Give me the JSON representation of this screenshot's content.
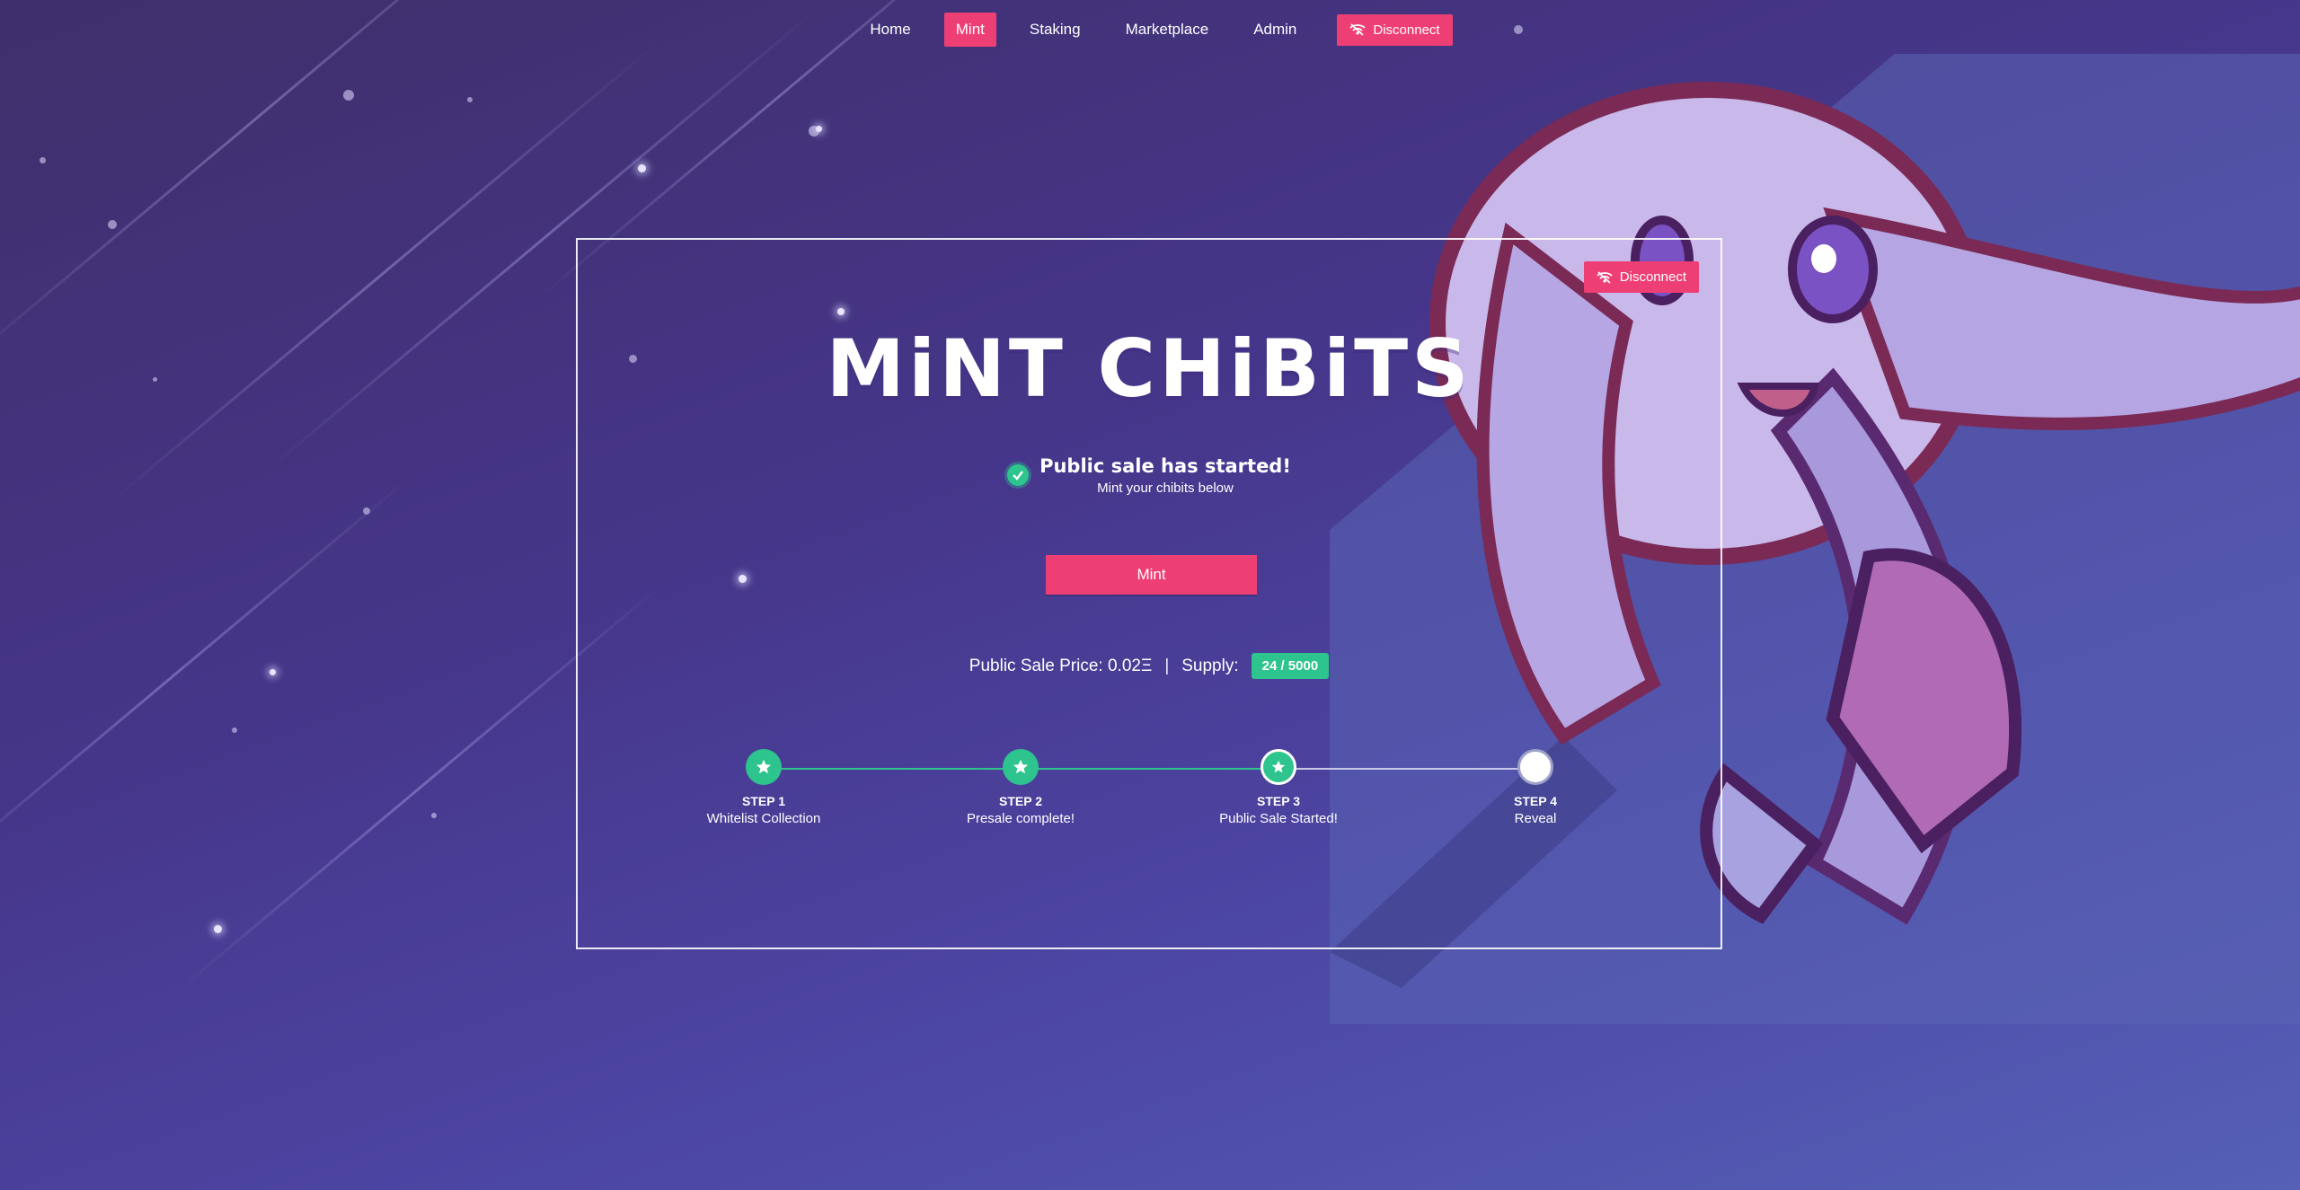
{
  "nav": {
    "items": [
      {
        "label": "Home",
        "active": false
      },
      {
        "label": "Mint",
        "active": true
      },
      {
        "label": "Staking",
        "active": false
      },
      {
        "label": "Marketplace",
        "active": false
      },
      {
        "label": "Admin",
        "active": false
      }
    ],
    "disconnect_label": "Disconnect",
    "disconnect_icon": "wifi-off-icon"
  },
  "mint_panel": {
    "disconnect_label": "Disconnect",
    "title": "MiNT CHiBiTS",
    "status_title": "Public sale has started!",
    "status_subtitle": "Mint your chibits below",
    "mint_button_label": "Mint",
    "price_text": "Public Sale Price: 0.02Ξ",
    "separator": "|",
    "supply_label": "Supply:",
    "supply_value": "24 / 5000"
  },
  "steps": [
    {
      "number": "STEP 1",
      "label": "Whitelist Collection",
      "state": "done"
    },
    {
      "number": "STEP 2",
      "label": "Presale complete!",
      "state": "done"
    },
    {
      "number": "STEP 3",
      "label": "Public Sale Started!",
      "state": "current"
    },
    {
      "number": "STEP 4",
      "label": "Reveal",
      "state": "todo"
    }
  ],
  "colors": {
    "accent": "#ee3f75",
    "success": "#2ec48e",
    "background": "#46368a"
  }
}
